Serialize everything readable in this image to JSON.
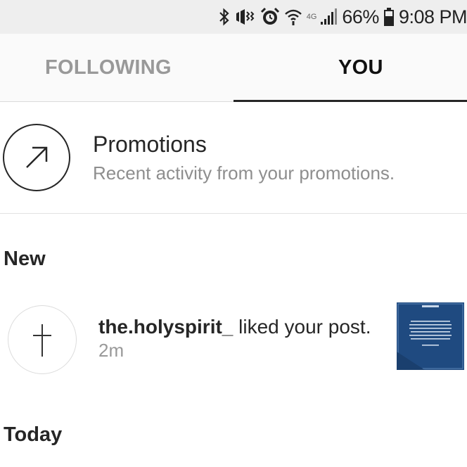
{
  "status_bar": {
    "network_label": "4G",
    "battery": "66%",
    "time": "9:08 PM",
    "icons": [
      "bluetooth-icon",
      "vibrate-icon",
      "alarm-icon",
      "wifi-icon",
      "signal-icon",
      "battery-icon"
    ]
  },
  "tabs": [
    {
      "label": "FOLLOWING",
      "active": false
    },
    {
      "label": "YOU",
      "active": true
    }
  ],
  "promotions": {
    "icon": "arrow-up-right-icon",
    "title": "Promotions",
    "subtitle": "Recent activity from your promotions."
  },
  "sections": {
    "new_title": "New",
    "today_title": "Today"
  },
  "notifications": [
    {
      "username": "the.holyspirit_",
      "action": " liked your post.",
      "time": "2m",
      "avatar_icon": "cross-icon",
      "thumbnail_icon": "post-thumbnail-image"
    }
  ],
  "colors": {
    "status_bg": "#eeeeee",
    "tab_active": "#111111",
    "tab_inactive": "#999999",
    "secondary_text": "#8e8e8e",
    "thumbnail_bg": "#1f4a80"
  }
}
